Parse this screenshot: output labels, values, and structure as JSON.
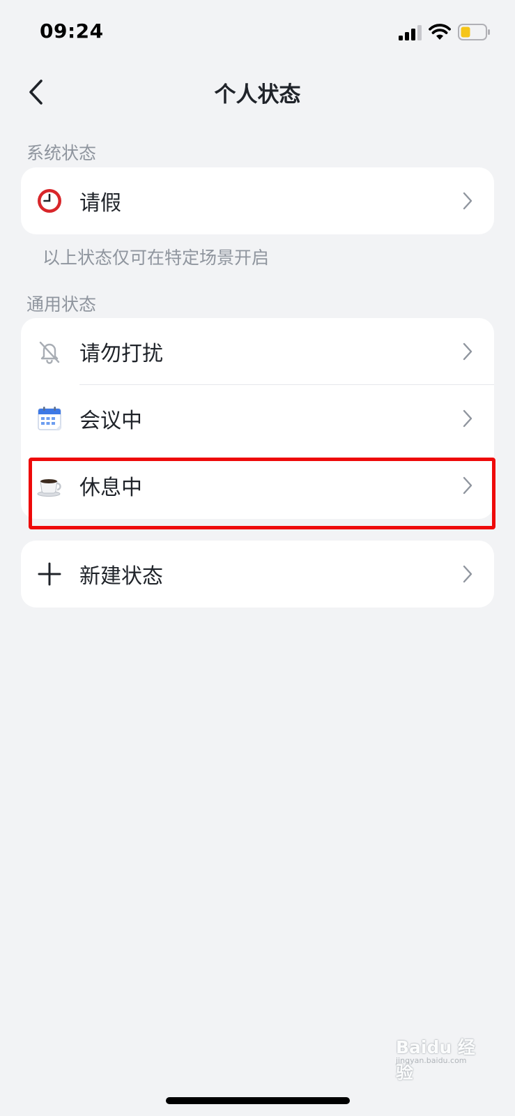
{
  "status_bar": {
    "time": "09:24",
    "battery_color": "#f5c518"
  },
  "nav": {
    "title": "个人状态"
  },
  "system_section": {
    "label": "系统状态",
    "items": [
      {
        "label": "请假",
        "icon": "clock-icon"
      }
    ],
    "hint": "以上状态仅可在特定场景开启"
  },
  "general_section": {
    "label": "通用状态",
    "items": [
      {
        "label": "请勿打扰",
        "icon": "bell-off-icon"
      },
      {
        "label": "会议中",
        "icon": "calendar-icon"
      },
      {
        "label": "休息中",
        "icon": "coffee-cup-icon"
      }
    ]
  },
  "new_status": {
    "label": "新建状态",
    "icon": "plus-icon"
  },
  "highlight_color": "#ee0a0a",
  "watermark": {
    "text": "Baidu 经验",
    "sub": "jingyan.baidu.com"
  }
}
